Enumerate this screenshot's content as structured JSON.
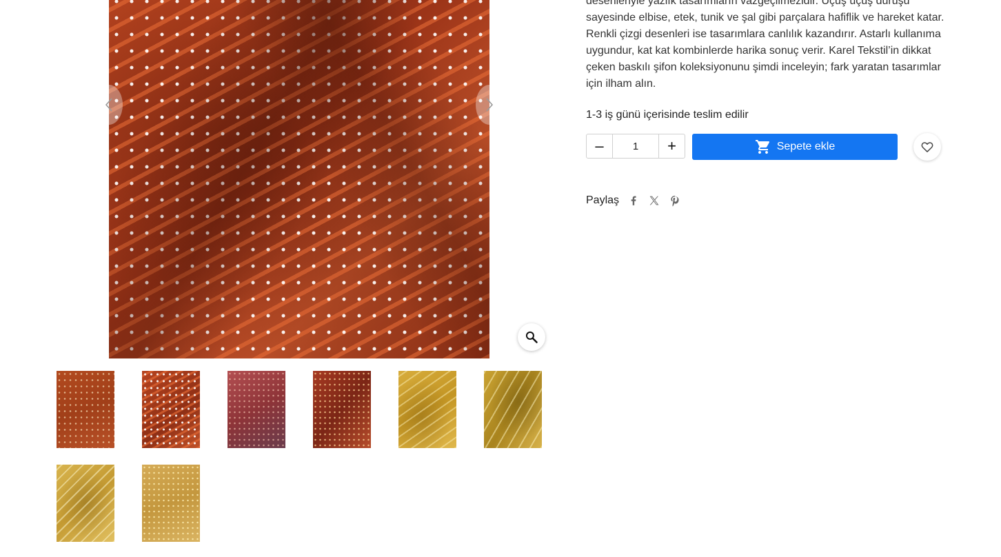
{
  "product": {
    "description": "desenleriyle yazlık tasarımların vazgeçilmezidir. Uçuş uçuş duruşu sayesinde elbise, etek, tunik ve şal gibi parçalara hafiflik ve hareket katar. Renkli çizgi desenleri ise tasarımlara canlılık kazandırır. Astarlı kullanıma uygundur, kat kat kombinlerde harika sonuç verir. Karel Tekstil’in dikkat çeken baskılı şifon koleksiyonunu şimdi inceleyin; fark yaratan tasarımlar için ilham alın.",
    "delivery": "1-3 iş günü içerisinde teslim edilir"
  },
  "quantity": {
    "minus_label": "–",
    "value": "1",
    "plus_label": "+"
  },
  "cart": {
    "add_label": "Sepete ekle",
    "icon": "shopping-cart-icon",
    "color": "#1476f2"
  },
  "wishlist": {
    "icon": "heart-icon"
  },
  "share": {
    "label": "Paylaş",
    "icons": [
      "facebook-icon",
      "x-twitter-icon",
      "pinterest-icon"
    ]
  },
  "gallery": {
    "icons": [
      "chevron-left-icon",
      "chevron-right-icon",
      "zoom-icon"
    ],
    "selected_index": 1,
    "thumbnail_count": 8
  }
}
